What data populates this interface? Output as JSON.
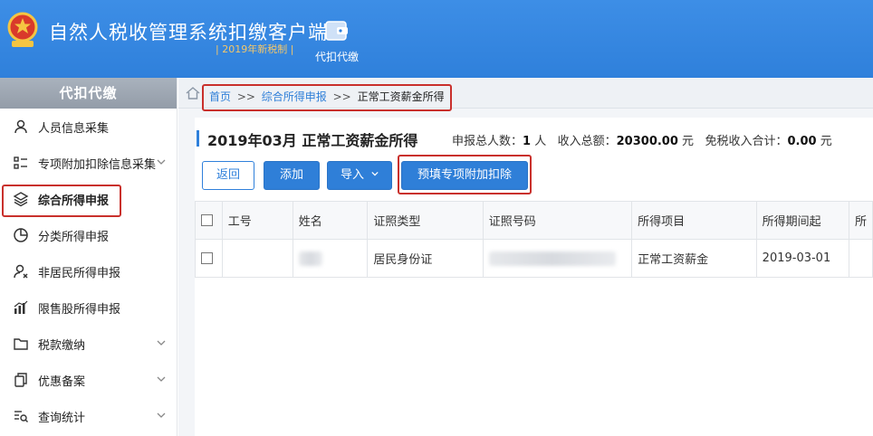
{
  "header": {
    "title": "自然人税收管理系统扣缴客户端",
    "subtitle": "| 2019年新税制 |",
    "nav": {
      "label": "代扣代缴",
      "icon": "wallet-icon"
    }
  },
  "sidebar": {
    "heading": "代扣代缴",
    "items": [
      {
        "label": "人员信息采集",
        "icon": "person-icon"
      },
      {
        "label": "专项附加扣除信息采集",
        "icon": "list-icon",
        "expandable": true
      },
      {
        "label": "综合所得申报",
        "icon": "layers-icon",
        "active": true
      },
      {
        "label": "分类所得申报",
        "icon": "pie-icon"
      },
      {
        "label": "非居民所得申报",
        "icon": "person-outline-icon"
      },
      {
        "label": "限售股所得申报",
        "icon": "bar-chart-icon"
      },
      {
        "label": "税款缴纳",
        "icon": "folder-icon",
        "expandable": true
      },
      {
        "label": "优惠备案",
        "icon": "copy-icon",
        "expandable": true
      },
      {
        "label": "查询统计",
        "icon": "search-list-icon",
        "expandable": true
      }
    ]
  },
  "breadcrumb": {
    "home": "首页",
    "sep": ">>",
    "level2": "综合所得申报",
    "current": "正常工资薪金所得"
  },
  "page": {
    "title": "2019年03月 正常工资薪金所得",
    "summary": {
      "count_label": "申报总人数：",
      "count": "1",
      "count_unit": "人",
      "income_label": "收入总额：",
      "income": "20300.00",
      "income_unit": "元",
      "exempt_label": "免税收入合计：",
      "exempt": "0.00",
      "exempt_unit": "元"
    }
  },
  "toolbar": {
    "back": "返回",
    "add": "添加",
    "import": "导入",
    "prefill": "预填专项附加扣除"
  },
  "table": {
    "columns": [
      "工号",
      "姓名",
      "证照类型",
      "证照号码",
      "所得项目",
      "所得期间起",
      "所"
    ],
    "rows": [
      {
        "id": "",
        "name": "",
        "id_type": "居民身份证",
        "id_number": "",
        "income_item": "正常工资薪金",
        "period_start": "2019-03-01"
      }
    ]
  },
  "colors": {
    "header_blue": "#2f80db",
    "accent_red": "#c9302c",
    "subtitle_gold": "#f4c76a"
  }
}
